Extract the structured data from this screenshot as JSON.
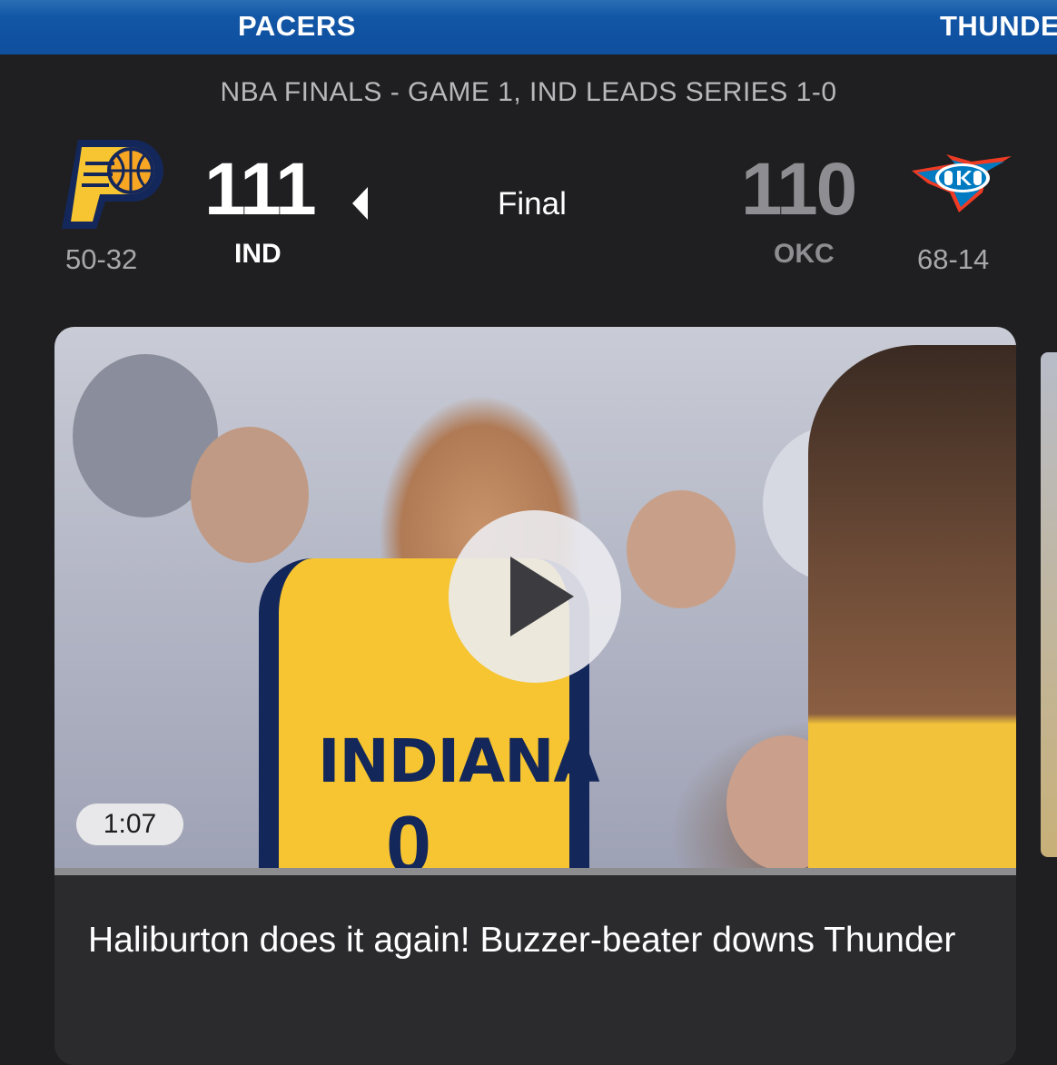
{
  "tabs": [
    {
      "label": "PACERS"
    },
    {
      "label": "THUNDER"
    }
  ],
  "series_note": "NBA FINALS - GAME 1, IND LEADS SERIES 1-0",
  "home": {
    "abbr": "IND",
    "score": "111",
    "record": "50-32",
    "logo_icon": "pacers-logo-icon"
  },
  "away": {
    "abbr": "OKC",
    "score": "110",
    "record": "68-14",
    "logo_icon": "thunder-logo-icon"
  },
  "game_status": "Final",
  "video": {
    "duration": "1:07",
    "headline": "Haliburton does it again! Buzzer-beater downs Thunder",
    "jersey_text": "INDIANA",
    "jersey_number": "0",
    "play_icon": "play-icon"
  },
  "colors": {
    "header_blue": "#0f4f9e",
    "background": "#1f1f21",
    "card": "#2b2b2e",
    "pacers_gold": "#f6c531",
    "pacers_navy": "#14275a",
    "loser_gray": "#8e8e92"
  }
}
